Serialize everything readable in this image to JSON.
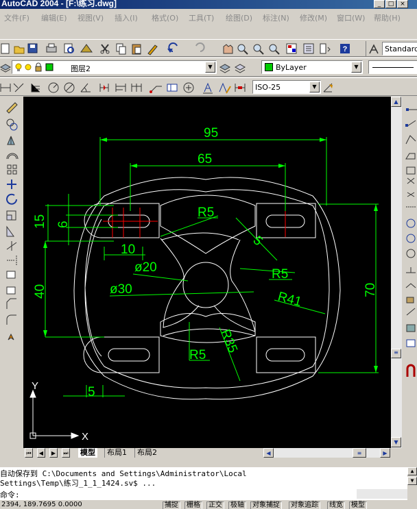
{
  "window": {
    "title": "AutoCAD 2004 - [F:\\练习.dwg]"
  },
  "menu": [
    "文件(F)",
    "编辑(E)",
    "视图(V)",
    "插入(I)",
    "格式(O)",
    "工具(T)",
    "绘图(D)",
    "标注(N)",
    "修改(M)",
    "窗口(W)",
    "帮助(H)"
  ],
  "toolbar": {
    "text_style": "Standard",
    "layer": "图层2",
    "color": "ByLayer",
    "color_swatch": "#00cc00",
    "dim_style": "ISO-25"
  },
  "drawing": {
    "dims": {
      "d95": "95",
      "d65": "65",
      "d15": "15",
      "d6": "6",
      "d10": "10",
      "d40": "40",
      "d70": "70",
      "d5a": "5",
      "d5b": "5"
    },
    "notes": {
      "r5a": "R5",
      "r5b": "R5",
      "r5c": "R5",
      "phi20": "ø20",
      "phi30": "ø30",
      "r41": "R41",
      "r35": "R35"
    },
    "ucs": {
      "x": "X",
      "y": "Y"
    }
  },
  "tabs": [
    "模型",
    "布局1",
    "布局2"
  ],
  "command": {
    "line1": "自动保存到 C:\\Documents and Settings\\Administrator\\Local",
    "line2": "Settings\\Temp\\练习_1_1_1424.sv$ ...",
    "prompt": "命令:"
  },
  "status": {
    "coords": "2394, 189.7695 0.0000",
    "buttons": [
      "捕捉",
      "栅格",
      "正交",
      "极轴",
      "对象捕捉",
      "对象追踪",
      "线宽",
      "模型"
    ]
  },
  "colors": {
    "dim": "#00ff00",
    "geom": "#ffffff",
    "center": "#ff0000",
    "canvas": "#000000"
  }
}
